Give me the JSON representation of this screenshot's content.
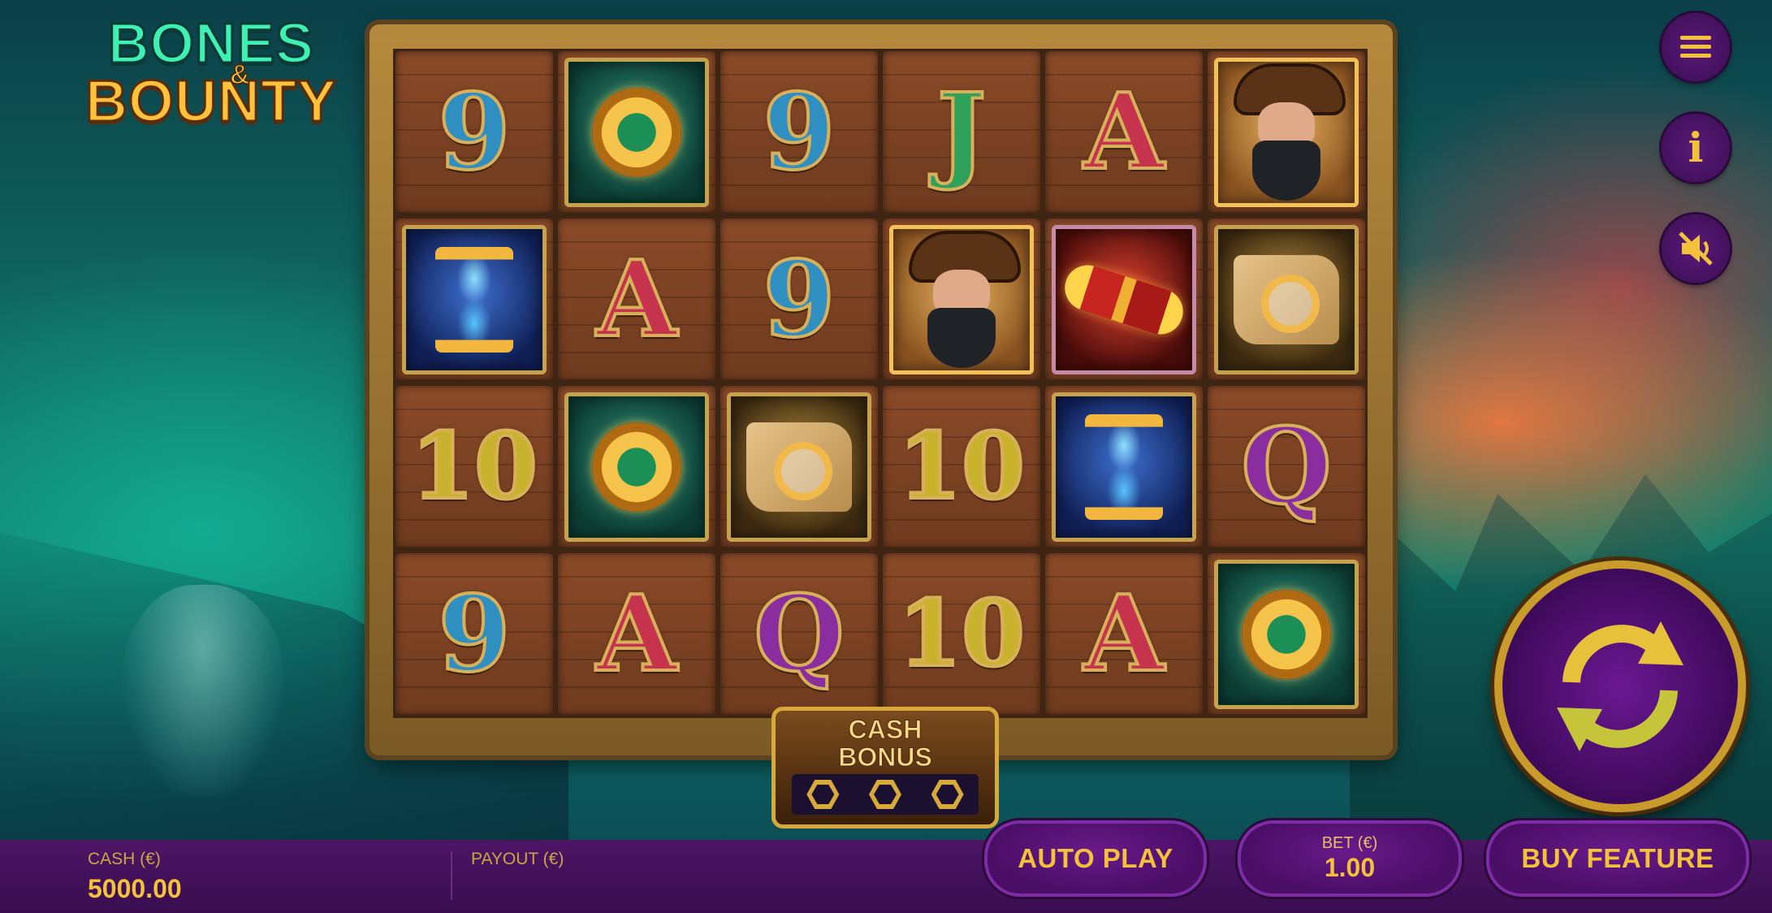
{
  "game": {
    "logo_line1": "BONES",
    "logo_amp": "&",
    "logo_line2": "BOUNTY"
  },
  "reels": {
    "rows": [
      [
        "9",
        "compass",
        "9",
        "J",
        "A",
        "pirate"
      ],
      [
        "hourglass",
        "A",
        "9",
        "pirate",
        "spyglass",
        "map"
      ],
      [
        "10",
        "compass",
        "map",
        "10",
        "hourglass",
        "Q"
      ],
      [
        "9",
        "A",
        "Q",
        "10",
        "A",
        "compass"
      ]
    ]
  },
  "cash_bonus": {
    "title_line1": "CASH",
    "title_line2": "BONUS",
    "slots": 3
  },
  "bottom_bar": {
    "cash_label": "CASH (€)",
    "cash_value": "5000.00",
    "payout_label": "PAYOUT (€)",
    "payout_value": ""
  },
  "controls": {
    "auto_play_label": "AUTO PLAY",
    "bet_label": "BET (€)",
    "bet_value": "1.00",
    "buy_feature_label": "BUY FEATURE",
    "menu_icon": "menu-icon",
    "info_icon": "info-icon",
    "sound_icon": "sound-muted-icon",
    "spin_icon": "spin-icon"
  },
  "colors": {
    "accent_gold": "#f3c23a",
    "ui_purple": "#4a0e66"
  }
}
